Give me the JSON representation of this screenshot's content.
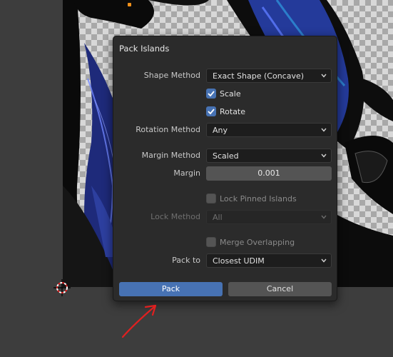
{
  "dialog": {
    "title": "Pack Islands",
    "shape_method": {
      "label": "Shape Method",
      "value": "Exact Shape (Concave)"
    },
    "scale": {
      "label": "Scale",
      "checked": true
    },
    "rotate": {
      "label": "Rotate",
      "checked": true
    },
    "rotation_method": {
      "label": "Rotation Method",
      "value": "Any"
    },
    "margin_method": {
      "label": "Margin Method",
      "value": "Scaled"
    },
    "margin": {
      "label": "Margin",
      "value": "0.001"
    },
    "lock_pinned_islands": {
      "label": "Lock Pinned Islands",
      "checked": false
    },
    "lock_method": {
      "label": "Lock Method",
      "value": "All",
      "enabled": false
    },
    "merge_overlapping": {
      "label": "Merge Overlapping",
      "checked": false
    },
    "pack_to": {
      "label": "Pack to",
      "value": "Closest UDIM"
    },
    "buttons": {
      "pack": "Pack",
      "cancel": "Cancel"
    }
  },
  "colors": {
    "accent": "#4772b3",
    "dialog_bg": "#2b2b2b",
    "annotation_arrow": "#e02020"
  },
  "icons": [
    "chevron-down-icon",
    "checkmark-icon",
    "cursor-3d-icon",
    "annotation-arrow-icon"
  ]
}
